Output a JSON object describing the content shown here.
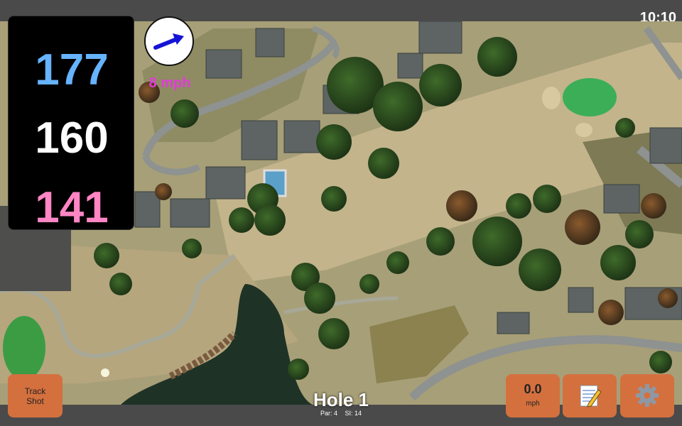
{
  "status": {
    "time": "10:10"
  },
  "distances": {
    "back": "177",
    "middle": "160",
    "front": "141"
  },
  "wind": {
    "speed": "8 mph",
    "icon": "wind-direction-arrow-icon"
  },
  "buttons": {
    "track_shot": [
      "Track",
      "Shot"
    ],
    "speed_value": "0.0",
    "speed_unit": "mph",
    "notes_icon": "notepad-icon",
    "settings_icon": "gear-icon"
  },
  "hole": {
    "title": "Hole 1",
    "par": "Par: 4",
    "si": "SI: 14"
  },
  "colors": {
    "back": "#66b3ff",
    "middle": "#ffffff",
    "front": "#ff85c4",
    "wind_text": "#e23bd8",
    "button": "#d4703e",
    "bar": "#4a4a4a"
  }
}
